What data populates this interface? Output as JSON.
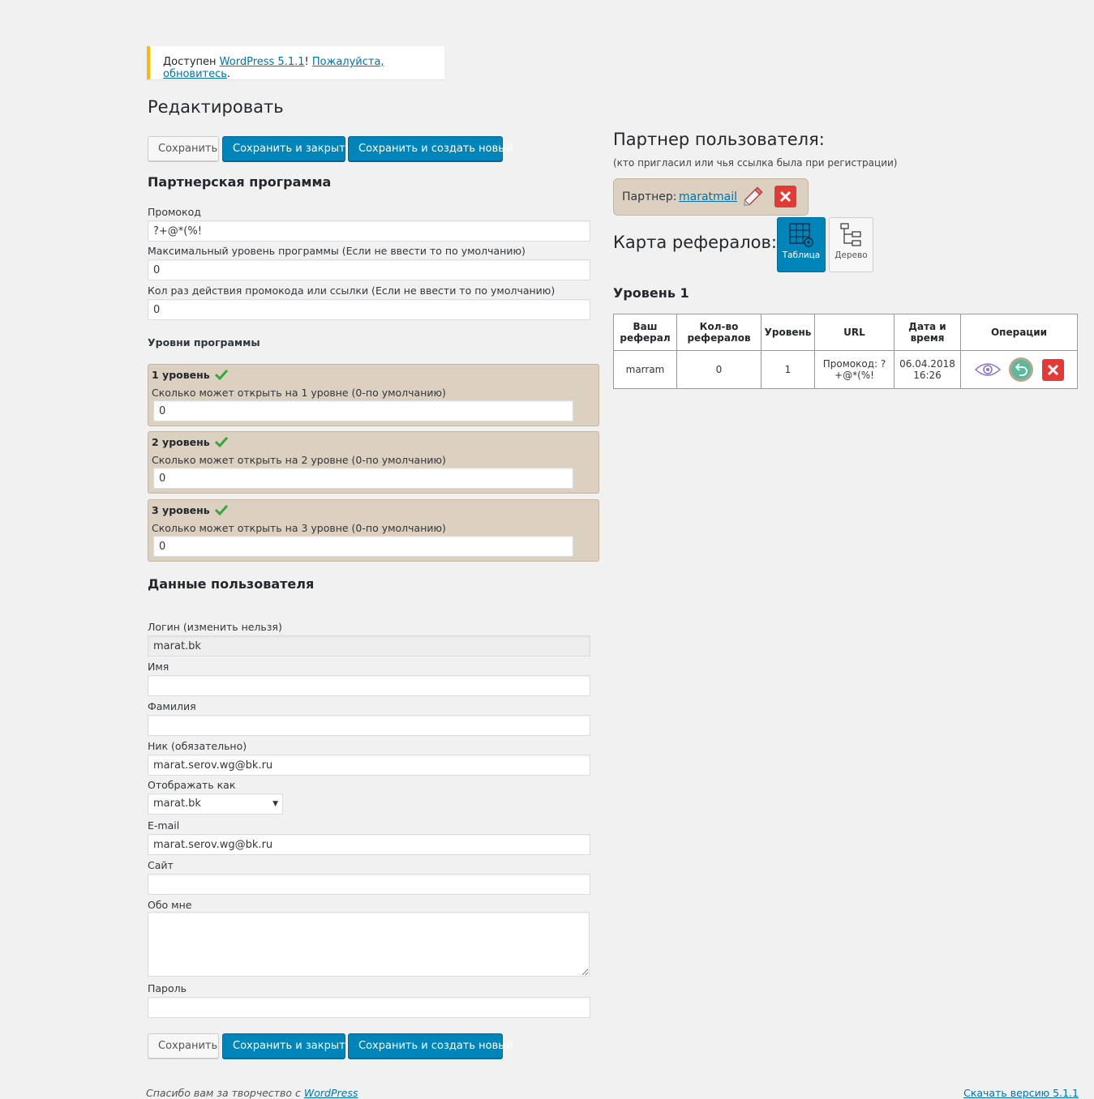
{
  "notice": {
    "prefix": "Доступен",
    "wp_link": "WordPress 5.1.1",
    "bang": "!",
    "update_link": "Пожалуйста, обновитесь",
    "dot": "."
  },
  "page_title": "Редактировать",
  "toolbar": {
    "save": "Сохранить",
    "save_close": "Сохранить и закрыть",
    "save_new": "Сохранить и создать новый"
  },
  "affiliate": {
    "heading": "Партнерская программа",
    "promo_label": "Промокод",
    "promo_value": "?+@*(%!",
    "max_level_label": "Максимальный уровень программы (Если не ввести то по умолчанию)",
    "max_level_value": "0",
    "uses_label": "Кол раз действия промокода или ссылки (Если не ввести то по умолчанию)",
    "uses_value": "0",
    "levels_heading": "Уровни программы",
    "levels": [
      {
        "title": "1 уровень",
        "desc": "Сколько может открыть на 1 уровне (0-по умолчанию)",
        "value": "0"
      },
      {
        "title": "2 уровень",
        "desc": "Сколько может открыть на 2 уровне (0-по умолчанию)",
        "value": "0"
      },
      {
        "title": "3 уровень",
        "desc": "Сколько может открыть на 3 уровне (0-по умолчанию)",
        "value": "0"
      }
    ]
  },
  "user": {
    "heading": "Данные пользователя",
    "login_label": "Логин (изменить нельзя)",
    "login_value": "marat.bk",
    "first_name_label": "Имя",
    "first_name_value": "",
    "last_name_label": "Фамилия",
    "last_name_value": "",
    "nick_label": "Ник (обязательно)",
    "nick_value": "marat.serov.wg@bk.ru",
    "display_label": "Отображать как",
    "display_value": "marat.bk",
    "email_label": "E-mail",
    "email_value": "marat.serov.wg@bk.ru",
    "site_label": "Сайт",
    "site_value": "",
    "about_label": "Обо мне",
    "about_value": "",
    "password_label": "Пароль",
    "password_value": ""
  },
  "partner": {
    "heading": "Партнер пользователя:",
    "sub": "(кто пригласил или чья ссылка была при регистрации)",
    "label": "Партнер:",
    "name": "maratmail"
  },
  "referral_map": {
    "heading": "Карта рефералов:",
    "view_table": "Таблица",
    "view_tree": "Дерево",
    "level_heading": "Уровень 1",
    "columns": [
      "Ваш реферал",
      "Кол-во рефералов",
      "Уровень",
      "URL",
      "Дата и время",
      "Операции"
    ],
    "rows": [
      {
        "referral": "marram",
        "count": "0",
        "level": "1",
        "url": "Промокод: ?+@*(%!",
        "date": "06.04.2018 16:26"
      }
    ]
  },
  "footer": {
    "thanks_prefix": "Спасибо вам за творчество с ",
    "thanks_link": "WordPress",
    "version_link": "Скачать версию 5.1.1"
  },
  "colors": {
    "primary_button": "#0085ba",
    "level_box": "#dcd0c0",
    "notice_accent": "#ffb900",
    "delete_red": "#e53935"
  }
}
